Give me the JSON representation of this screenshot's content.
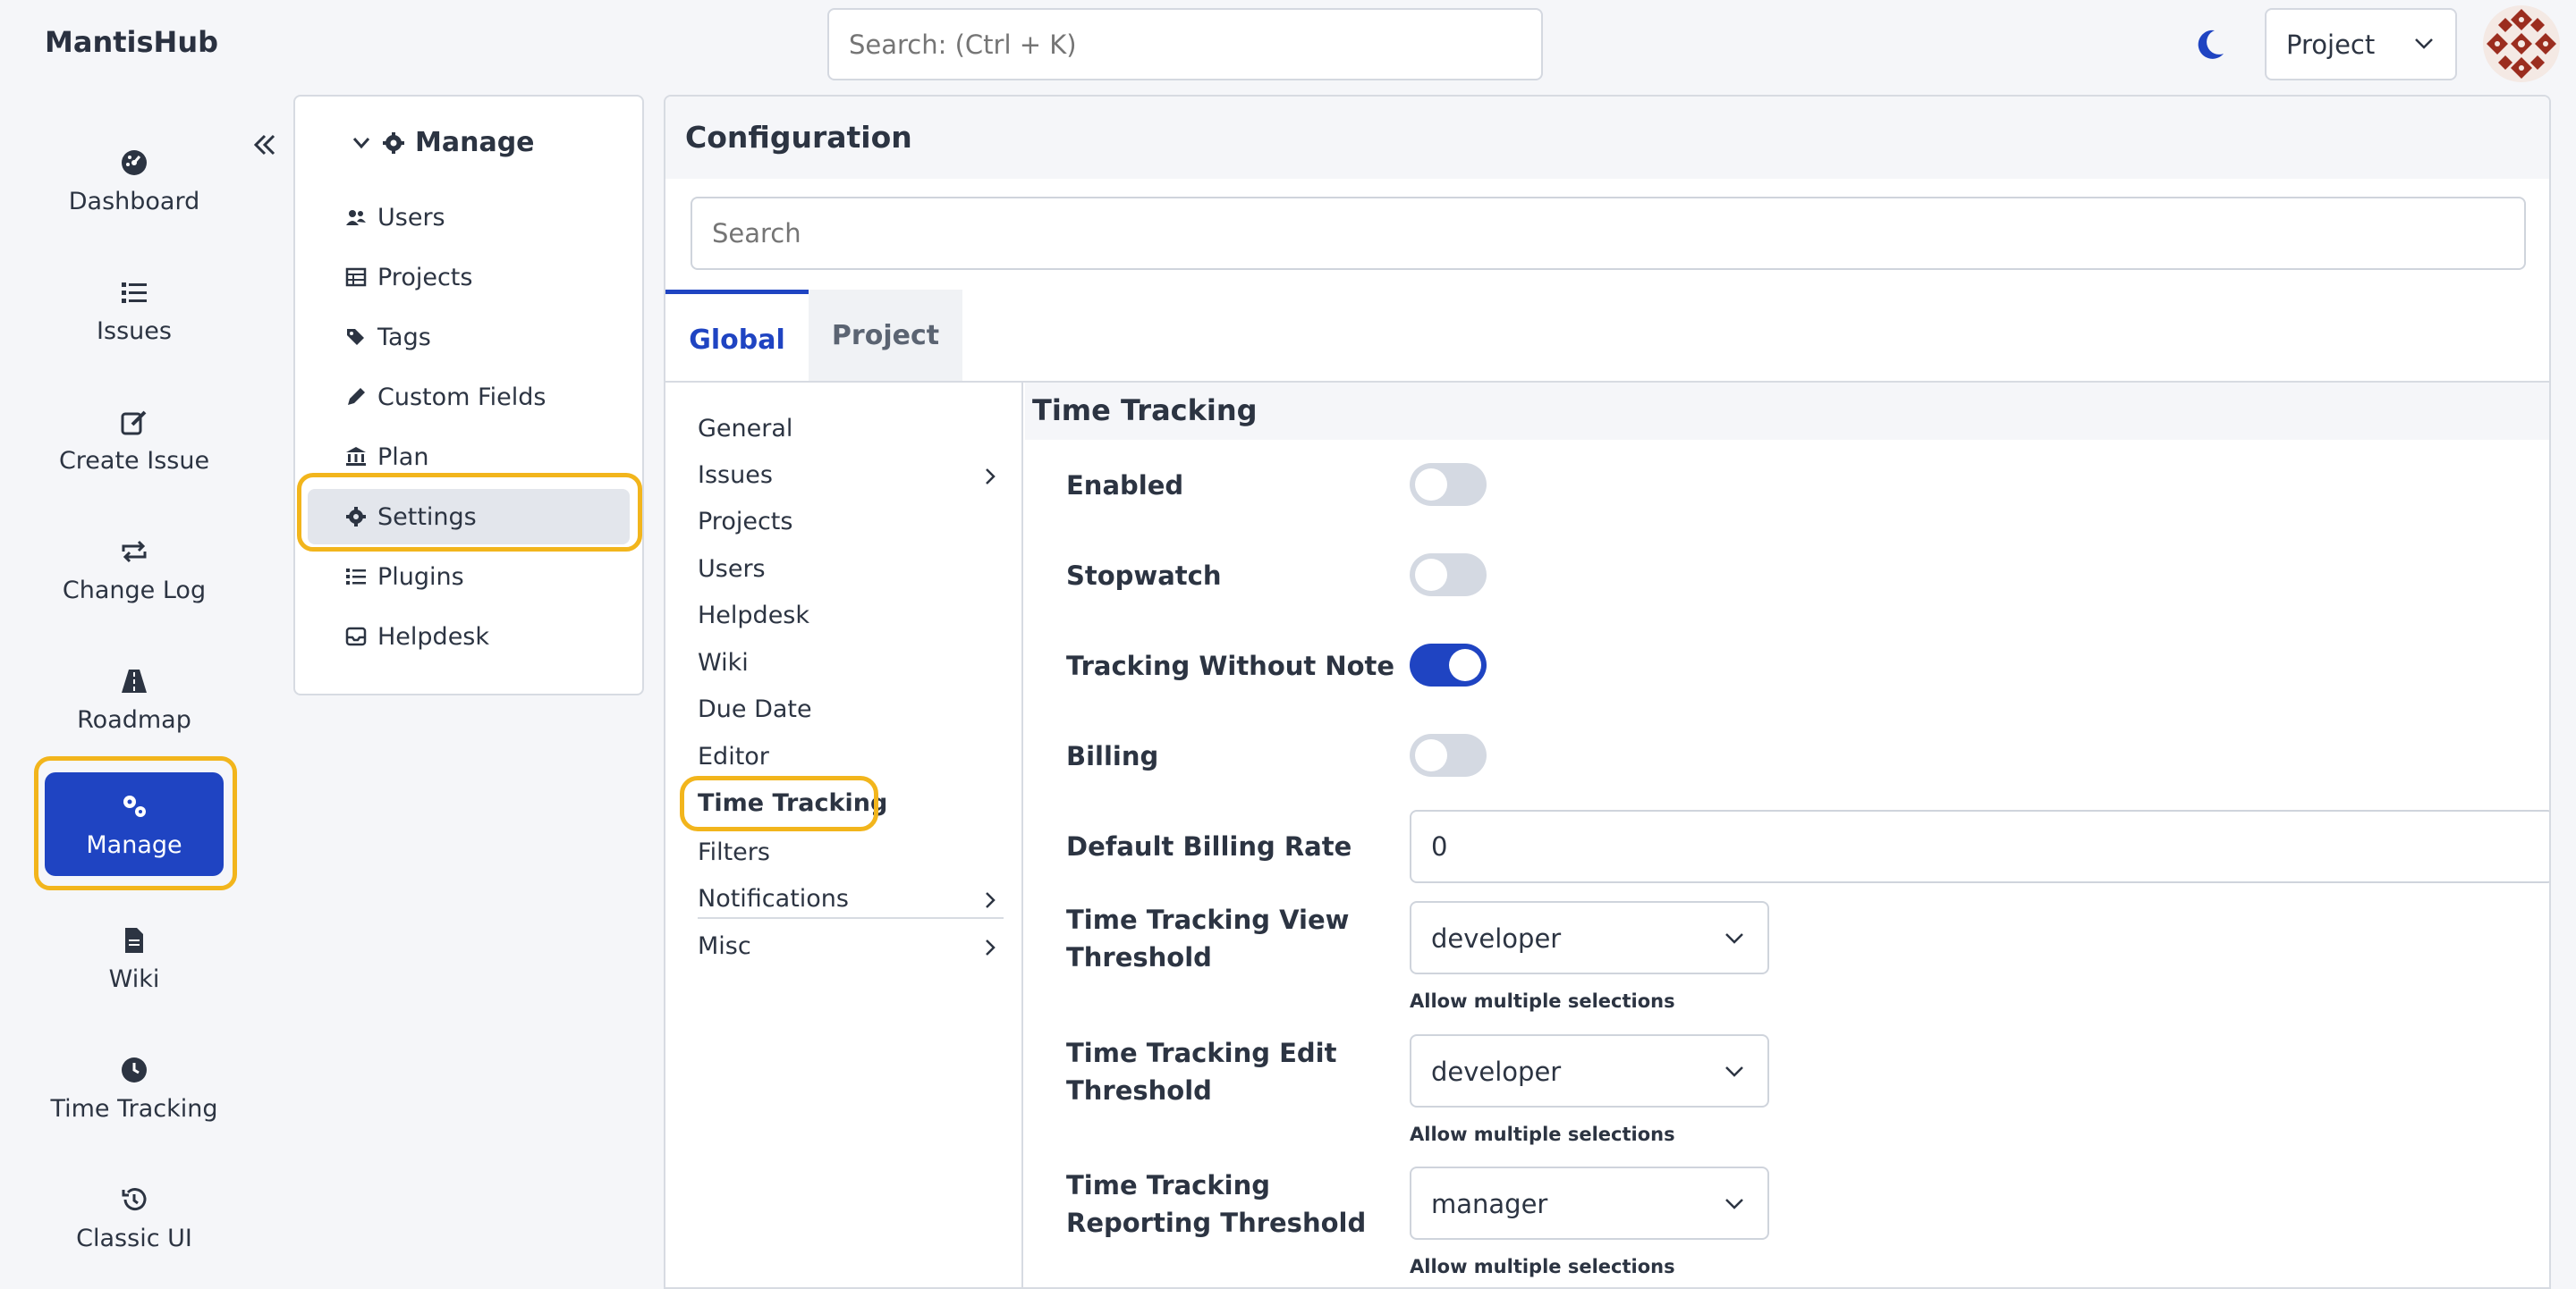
{
  "app": {
    "title": "MantisHub"
  },
  "header": {
    "search_placeholder": "Search: (Ctrl + K)",
    "project_select": "Project"
  },
  "colors": {
    "accent": "#1f44c2",
    "highlight": "#f2b51c"
  },
  "leftnav": {
    "items": [
      {
        "label": "Dashboard",
        "icon": "dashboard-icon"
      },
      {
        "label": "Issues",
        "icon": "list-icon"
      },
      {
        "label": "Create Issue",
        "icon": "edit-icon"
      },
      {
        "label": "Change Log",
        "icon": "changelog-icon"
      },
      {
        "label": "Roadmap",
        "icon": "road-icon"
      },
      {
        "label": "Manage",
        "icon": "gears-icon",
        "active": true
      },
      {
        "label": "Wiki",
        "icon": "file-icon"
      },
      {
        "label": "Time Tracking",
        "icon": "clock-icon"
      },
      {
        "label": "Classic UI",
        "icon": "history-icon"
      }
    ]
  },
  "manage": {
    "title": "Manage",
    "items": [
      {
        "label": "Users",
        "icon": "users-icon"
      },
      {
        "label": "Projects",
        "icon": "table-icon"
      },
      {
        "label": "Tags",
        "icon": "tags-icon"
      },
      {
        "label": "Custom Fields",
        "icon": "pencil-icon"
      },
      {
        "label": "Plan",
        "icon": "bank-icon"
      },
      {
        "label": "Settings",
        "icon": "gear-icon",
        "active": true
      },
      {
        "label": "Plugins",
        "icon": "list-icon"
      },
      {
        "label": "Helpdesk",
        "icon": "inbox-icon"
      }
    ]
  },
  "config": {
    "title": "Configuration",
    "search_placeholder": "Search",
    "tabs": [
      {
        "label": "Global",
        "active": true
      },
      {
        "label": "Project"
      }
    ],
    "sections": [
      {
        "label": "General"
      },
      {
        "label": "Issues",
        "has_children": true
      },
      {
        "label": "Projects"
      },
      {
        "label": "Users"
      },
      {
        "label": "Helpdesk"
      },
      {
        "label": "Wiki"
      },
      {
        "label": "Due Date"
      },
      {
        "label": "Editor"
      },
      {
        "label": "Time Tracking",
        "active": true
      },
      {
        "label": "Filters"
      },
      {
        "label": "Notifications",
        "has_children": true
      },
      {
        "label": "Misc",
        "has_children": true
      }
    ]
  },
  "time_tracking": {
    "title": "Time Tracking",
    "enabled": {
      "label": "Enabled",
      "value": false
    },
    "stopwatch": {
      "label": "Stopwatch",
      "value": false
    },
    "tracking_without_note": {
      "label": "Tracking Without Note",
      "value": true
    },
    "billing": {
      "label": "Billing",
      "value": false
    },
    "default_billing_rate": {
      "label": "Default Billing Rate",
      "value": "0"
    },
    "view_threshold": {
      "label": "Time Tracking View Threshold",
      "value": "developer",
      "hint": "Allow multiple selections"
    },
    "edit_threshold": {
      "label": "Time Tracking Edit Threshold",
      "value": "developer",
      "hint": "Allow multiple selections"
    },
    "reporting_threshold": {
      "label": "Time Tracking Reporting Threshold",
      "value": "manager",
      "hint": "Allow multiple selections"
    }
  }
}
